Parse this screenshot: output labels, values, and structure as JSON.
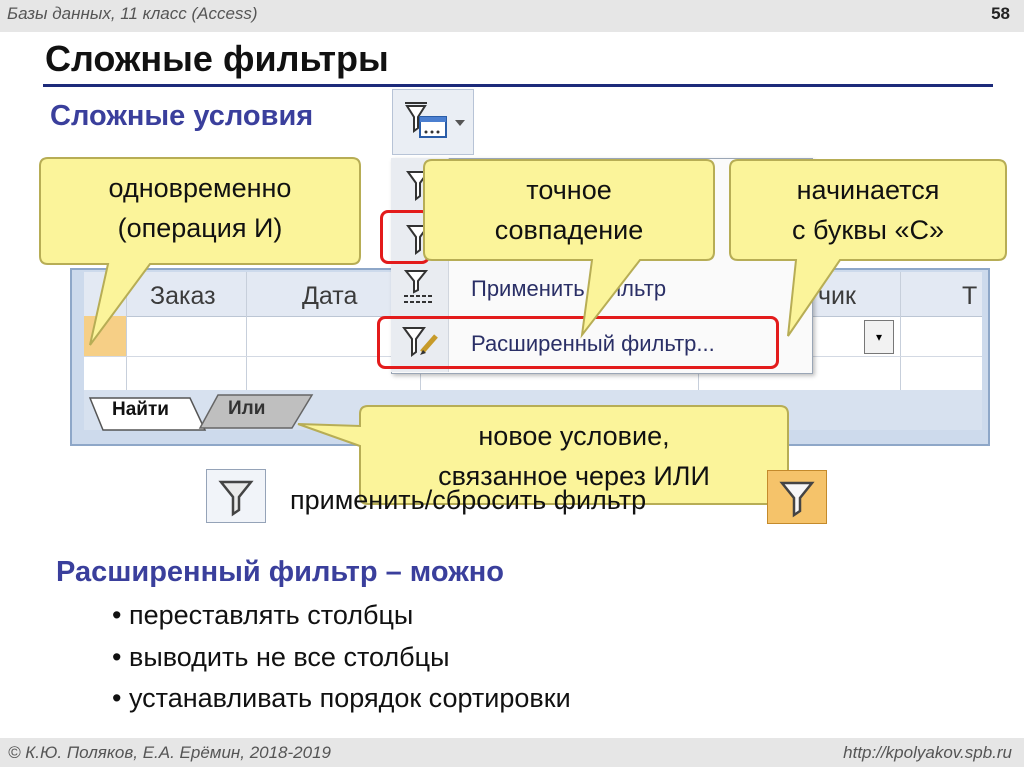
{
  "header": {
    "course": "Базы данных, 11 класс (Access)",
    "slide_number": "58"
  },
  "title": "Сложные фильтры",
  "subtitle": "Сложные условия",
  "access": {
    "columns": [
      "Заказ",
      "Дата",
      "чик",
      "Т"
    ],
    "menu": {
      "items": [
        {
          "label": "",
          "icon": "filter-form-icon"
        },
        {
          "label": "",
          "icon": "filter-selection-icon"
        },
        {
          "label": "Применить фильтр",
          "icon": "apply-filter-icon"
        },
        {
          "label": "Расширенный фильтр...",
          "icon": "advanced-filter-icon"
        }
      ],
      "partial_label": "р"
    },
    "tabs": [
      "Найти",
      "Или"
    ],
    "combo_arrow": "▾"
  },
  "callouts": {
    "and": "одновременно\n(операция И)",
    "exact": "точное\nсовпадение",
    "starts": "начинается\nс буквы «С»",
    "or": "новое условие,\nсвязанное через ИЛИ"
  },
  "apply_reset": "применить/сбросить фильтр",
  "advanced": {
    "title": "Расширенный фильтр – можно",
    "bullets": [
      "переставлять столбцы",
      "выводить не все столбцы",
      "устанавливать порядок  сортировки"
    ]
  },
  "footer": {
    "authors": "© К.Ю. Поляков, Е.А. Ерёмин, 2018-2019",
    "url": "http://kpolyakov.spb.ru"
  },
  "colors": {
    "accent": "#3a3f9c",
    "callout_fill": "#fbf49a",
    "highlight": "#e31b1b"
  }
}
